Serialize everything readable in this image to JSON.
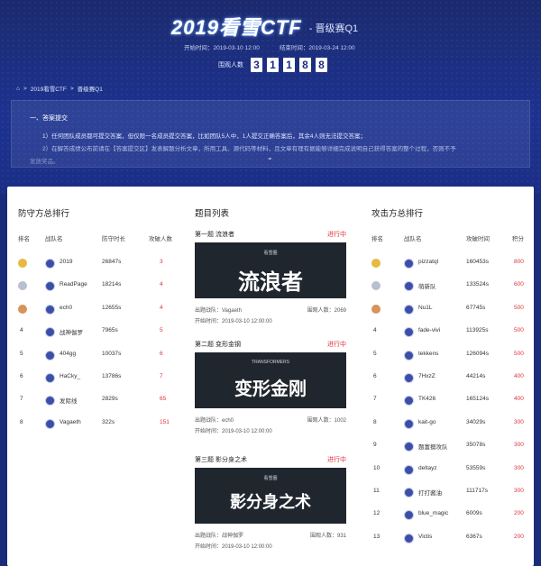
{
  "header": {
    "title": "2019看雪CTF",
    "subtitle": "- 晋级赛Q1",
    "start_label": "开始时间：2019-03-10 12:00",
    "end_label": "结束时间：2019-03-24 12:00",
    "viewers_label": "围观人数",
    "viewers_digits": [
      "3",
      "1",
      "1",
      "8",
      "8"
    ]
  },
  "breadcrumb": {
    "items": [
      "2019看雪CTF",
      "晋级赛Q1"
    ],
    "sep": ">"
  },
  "notice": {
    "heading": "一、答案提交",
    "line1": "1）任何团队成员都可提交答案，但仅限一名成员提交答案，比如团队5人中，1人提交正确答案后，其余4人则无法提交答案；",
    "line2": "2）在解答成绩公布前请在【答案提交区】发表解题分析文章，所用工具、源代码等材料，且文章有理有据能够详细完成说明自己获得答案的整个过程，否则不予",
    "line3": "发放奖品。",
    "expand_icon": "chevron-down-icon"
  },
  "defense": {
    "title": "防守方总排行",
    "headers": [
      "排名",
      "战队名",
      "防守时长",
      "攻破人数"
    ],
    "rows": [
      {
        "rank": "1",
        "team": "2019",
        "time": "26847s",
        "count": "3"
      },
      {
        "rank": "2",
        "team": "ReadPage",
        "time": "18214s",
        "count": "4"
      },
      {
        "rank": "3",
        "team": "ech0",
        "time": "12655s",
        "count": "4"
      },
      {
        "rank": "4",
        "team": "战神伽罗",
        "time": "7965s",
        "count": "5"
      },
      {
        "rank": "5",
        "team": "404gg",
        "time": "10037s",
        "count": "6"
      },
      {
        "rank": "6",
        "team": "HaCky_",
        "time": "13786s",
        "count": "7"
      },
      {
        "rank": "7",
        "team": "发际线",
        "time": "2829s",
        "count": "65"
      },
      {
        "rank": "8",
        "team": "Vagaeth",
        "time": "322s",
        "count": "151"
      }
    ]
  },
  "tasks": {
    "title": "题目列表",
    "items": [
      {
        "title": "第一题 流浪者",
        "status": "进行中",
        "banner": "流浪者",
        "banner_sub": "看雪圈",
        "author": "出题战队：Vagaeth",
        "people": "围观人数：2069",
        "start": "开始时间：2019-03-10 12:00:00"
      },
      {
        "title": "第二题 变形金钢",
        "status": "进行中",
        "banner": "变形金刚",
        "banner_sub": "TRANSFORMERS",
        "author": "出题战队：ech0",
        "people": "围观人数：1002",
        "start": "开始时间：2019-03-10 12:00:00"
      },
      {
        "title": "第三题 影分身之术",
        "status": "进行中",
        "banner": "影分身之术",
        "banner_sub": "看雪圈",
        "author": "出题战队：战神伽罗",
        "people": "围观人数：931",
        "start": "开始时间：2019-03-10 12:00:00"
      }
    ]
  },
  "attack": {
    "title": "攻击方总排行",
    "headers": [
      "排名",
      "战队名",
      "攻破时间",
      "积分"
    ],
    "rows": [
      {
        "rank": "1",
        "team": "pizzatql",
        "time": "160453s",
        "score": "800"
      },
      {
        "rank": "2",
        "team": "萌新队",
        "time": "133524s",
        "score": "600"
      },
      {
        "rank": "3",
        "team": "Nu1L",
        "time": "67745s",
        "score": "500"
      },
      {
        "rank": "4",
        "team": "fade-vivi",
        "time": "113925s",
        "score": "500"
      },
      {
        "rank": "5",
        "team": "tekkens",
        "time": "126094s",
        "score": "500"
      },
      {
        "rank": "6",
        "team": "7HxzZ",
        "time": "44214s",
        "score": "400"
      },
      {
        "rank": "7",
        "team": "TK426",
        "time": "165124s",
        "score": "400"
      },
      {
        "rank": "8",
        "team": "kait-go",
        "time": "34029s",
        "score": "300"
      },
      {
        "rank": "9",
        "team": "题富擅攻队",
        "time": "35078s",
        "score": "300"
      },
      {
        "rank": "10",
        "team": "deltayz",
        "time": "53559s",
        "score": "300"
      },
      {
        "rank": "11",
        "team": "打打酱油",
        "time": "111717s",
        "score": "300"
      },
      {
        "rank": "12",
        "team": "blue_magic",
        "time": "6009s",
        "score": "200"
      },
      {
        "rank": "13",
        "team": "Victis",
        "time": "6367s",
        "score": "200"
      }
    ]
  },
  "colors": {
    "accent_red": "#e0303a",
    "hero_blue": "#1d3290"
  }
}
